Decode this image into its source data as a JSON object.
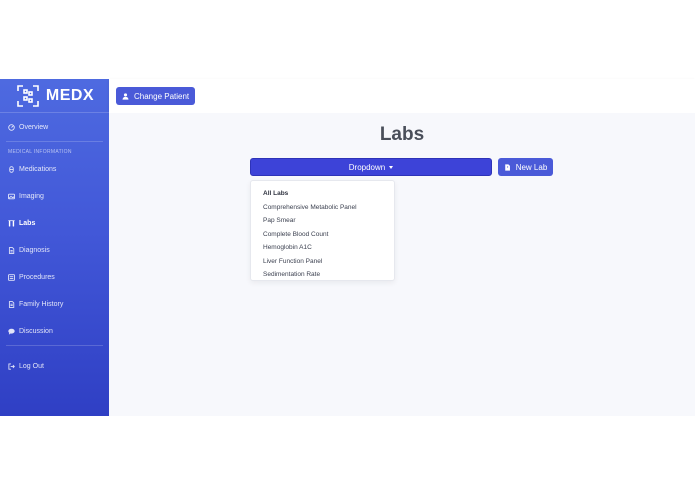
{
  "brand": {
    "name": "MEDX"
  },
  "sidebar": {
    "overview": "Overview",
    "section_heading": "MEDICAL INFORMATION",
    "items": [
      {
        "label": "Medications",
        "icon": "pill-icon"
      },
      {
        "label": "Imaging",
        "icon": "image-icon"
      },
      {
        "label": "Labs",
        "icon": "flask-icon",
        "active": true
      },
      {
        "label": "Diagnosis",
        "icon": "document-icon"
      },
      {
        "label": "Procedures",
        "icon": "list-icon"
      },
      {
        "label": "Family History",
        "icon": "file-icon"
      },
      {
        "label": "Discussion",
        "icon": "chat-icon"
      }
    ],
    "logout": "Log Out"
  },
  "topbar": {
    "change_patient": "Change Patient"
  },
  "main": {
    "title": "Labs",
    "dropdown_label": "Dropdown",
    "new_lab_label": "New Lab",
    "menu_items": [
      "All Labs",
      "Comprehensive Metabolic Panel",
      "Pap Smear",
      "Complete Blood Count",
      "Hemoglobin A1C",
      "Liver Function Panel",
      "Sedimentation Rate"
    ]
  },
  "colors": {
    "accent": "#3d43d8",
    "sidebar_top": "#4e6ae0",
    "sidebar_bottom": "#2f3fc4",
    "background": "#f7f8fc"
  }
}
